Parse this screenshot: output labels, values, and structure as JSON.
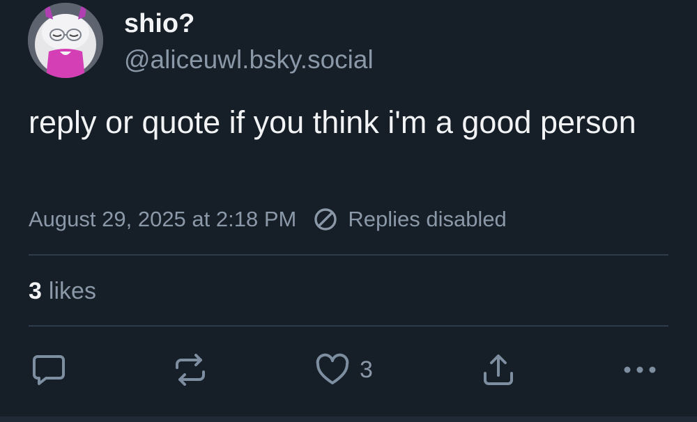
{
  "author": {
    "name": "shio?",
    "handle": "@aliceuwl.bsky.social",
    "avatar": "avatar-illustration"
  },
  "post": {
    "text": "reply or quote if you think i'm a good person",
    "timestamp": "August 29, 2025 at 2:18 PM",
    "replies_status": "Replies disabled"
  },
  "stats": {
    "likes_count": "3",
    "likes_label": "likes"
  },
  "actions": {
    "like_count": "3",
    "icons": [
      "reply-icon",
      "repost-icon",
      "like-icon",
      "share-icon",
      "more-icon"
    ]
  },
  "colors": {
    "background": "#161e27",
    "text_primary": "#f1f3f5",
    "text_secondary": "#8b98a8",
    "icon": "#7e8ea1",
    "divider": "#2e3b4b"
  }
}
